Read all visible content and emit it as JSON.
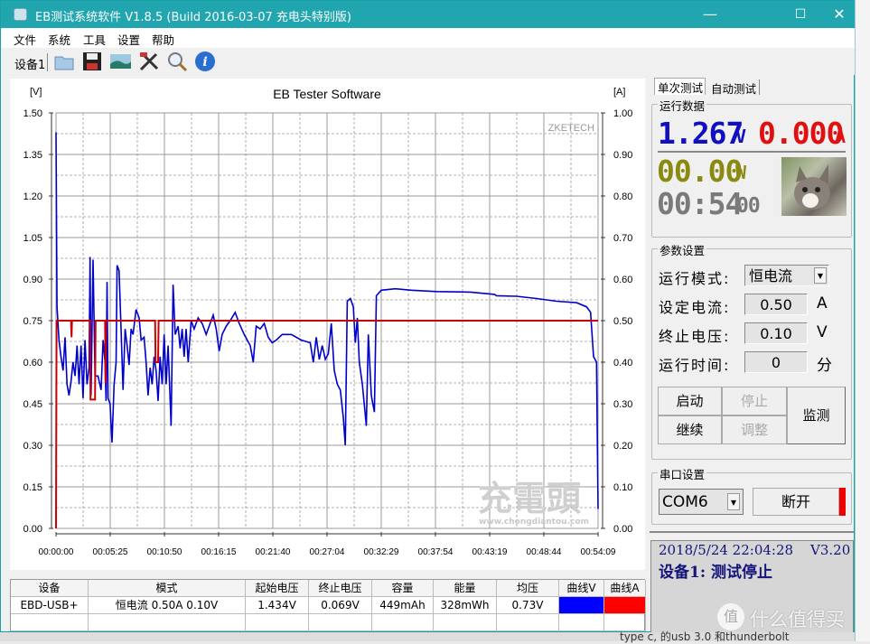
{
  "window": {
    "title": "EB测试系统软件 V1.8.5 (Build 2016-03-07 充电头特别版)",
    "minimize": "—",
    "maximize": "☐",
    "close": "✕"
  },
  "menu": [
    "文件",
    "系统",
    "工具",
    "设置",
    "帮助"
  ],
  "toolbar": {
    "device_tab": "设备1",
    "icons": [
      "open-folder-icon",
      "save-icon",
      "picture-icon",
      "tools-icon",
      "search-icon",
      "info-icon"
    ]
  },
  "chart": {
    "title": "EB Tester Software",
    "left_unit": "[V]",
    "right_unit": "[A]",
    "brand": "ZKETECH",
    "watermark": "充電頭",
    "watermark_url": "www.chongdiantou.com"
  },
  "chart_data": {
    "type": "line",
    "title": "EB Tester Software",
    "x_ticks": [
      "00:00:00",
      "00:05:25",
      "00:10:50",
      "00:16:15",
      "00:21:40",
      "00:27:04",
      "00:32:29",
      "00:37:54",
      "00:43:19",
      "00:48:44",
      "00:54:09"
    ],
    "xlim_minutes": [
      0,
      54.15
    ],
    "y_left": {
      "label": "[V]",
      "lim": [
        0,
        1.5
      ],
      "ticks": [
        "0.00",
        "0.15",
        "0.30",
        "0.45",
        "0.60",
        "0.75",
        "0.90",
        "1.05",
        "1.20",
        "1.35",
        "1.50"
      ]
    },
    "y_right": {
      "label": "[A]",
      "lim": [
        0,
        1.0
      ],
      "ticks": [
        "0.00",
        "0.10",
        "0.20",
        "0.30",
        "0.40",
        "0.50",
        "0.60",
        "0.70",
        "0.80",
        "0.90",
        "1.00"
      ]
    },
    "grid": true,
    "series": [
      {
        "axis": "left",
        "color": "#0000cc",
        "points": [
          [
            0,
            1.43
          ],
          [
            0.1,
            0.8
          ],
          [
            0.3,
            0.68
          ],
          [
            0.5,
            0.62
          ],
          [
            0.7,
            0.57
          ],
          [
            0.9,
            0.69
          ],
          [
            1.1,
            0.52
          ],
          [
            1.3,
            0.48
          ],
          [
            1.5,
            0.53
          ],
          [
            1.7,
            0.6
          ],
          [
            1.9,
            0.55
          ],
          [
            2.1,
            0.66
          ],
          [
            2.3,
            0.52
          ],
          [
            2.5,
            0.66
          ],
          [
            2.7,
            0.47
          ],
          [
            2.9,
            0.68
          ],
          [
            3.1,
            0.52
          ],
          [
            3.3,
            0.58
          ],
          [
            3.4,
            0.98
          ],
          [
            3.5,
            0.48
          ],
          [
            3.7,
            0.97
          ],
          [
            3.9,
            0.55
          ],
          [
            4.2,
            0.55
          ],
          [
            4.5,
            0.5
          ],
          [
            4.7,
            0.68
          ],
          [
            4.9,
            0.6
          ],
          [
            5.0,
            0.46
          ],
          [
            5.1,
            0.89
          ],
          [
            5.2,
            0.47
          ],
          [
            5.4,
            0.45
          ],
          [
            5.6,
            0.31
          ],
          [
            5.8,
            0.52
          ],
          [
            6.0,
            0.6
          ],
          [
            6.1,
            0.95
          ],
          [
            6.3,
            0.93
          ],
          [
            6.5,
            0.72
          ],
          [
            6.7,
            0.5
          ],
          [
            6.9,
            0.72
          ],
          [
            7.1,
            0.66
          ],
          [
            7.3,
            0.59
          ],
          [
            7.5,
            0.72
          ],
          [
            7.7,
            0.7
          ],
          [
            8.0,
            0.79
          ],
          [
            8.3,
            0.76
          ],
          [
            8.5,
            0.68
          ],
          [
            8.8,
            0.69
          ],
          [
            9.0,
            0.6
          ],
          [
            9.2,
            0.48
          ],
          [
            9.4,
            0.58
          ],
          [
            9.6,
            0.52
          ],
          [
            9.8,
            0.62
          ],
          [
            10.0,
            0.57
          ],
          [
            10.2,
            0.46
          ],
          [
            10.4,
            0.62
          ],
          [
            10.6,
            0.52
          ],
          [
            10.8,
            0.7
          ],
          [
            11.0,
            0.52
          ],
          [
            11.2,
            0.66
          ],
          [
            11.5,
            0.37
          ],
          [
            11.7,
            0.88
          ],
          [
            11.9,
            0.7
          ],
          [
            12.2,
            0.73
          ],
          [
            12.4,
            0.65
          ],
          [
            12.6,
            0.72
          ],
          [
            12.8,
            0.62
          ],
          [
            13.0,
            0.72
          ],
          [
            13.2,
            0.6
          ],
          [
            13.5,
            0.75
          ],
          [
            13.8,
            0.72
          ],
          [
            14.2,
            0.76
          ],
          [
            14.6,
            0.74
          ],
          [
            15.0,
            0.7
          ],
          [
            15.4,
            0.74
          ],
          [
            15.7,
            0.77
          ],
          [
            16.0,
            0.72
          ],
          [
            16.3,
            0.64
          ],
          [
            16.6,
            0.7
          ],
          [
            17.0,
            0.73
          ],
          [
            17.4,
            0.75
          ],
          [
            17.9,
            0.78
          ],
          [
            18.3,
            0.74
          ],
          [
            18.8,
            0.7
          ],
          [
            19.4,
            0.66
          ],
          [
            19.7,
            0.6
          ],
          [
            20.0,
            0.73
          ],
          [
            20.4,
            0.72
          ],
          [
            20.8,
            0.74
          ],
          [
            21.2,
            0.69
          ],
          [
            21.6,
            0.67
          ],
          [
            22.0,
            0.68
          ],
          [
            22.6,
            0.7
          ],
          [
            23.5,
            0.7
          ],
          [
            24.5,
            0.68
          ],
          [
            25.4,
            0.67
          ],
          [
            25.7,
            0.6
          ],
          [
            26.0,
            0.69
          ],
          [
            26.3,
            0.61
          ],
          [
            26.6,
            0.66
          ],
          [
            26.9,
            0.61
          ],
          [
            27.2,
            0.63
          ],
          [
            27.5,
            0.74
          ],
          [
            27.8,
            0.57
          ],
          [
            28.1,
            0.52
          ],
          [
            28.4,
            0.5
          ],
          [
            28.7,
            0.4
          ],
          [
            28.9,
            0.3
          ],
          [
            29.1,
            0.82
          ],
          [
            29.4,
            0.83
          ],
          [
            29.7,
            0.8
          ],
          [
            29.9,
            0.67
          ],
          [
            30.1,
            0.76
          ],
          [
            30.3,
            0.6
          ],
          [
            30.6,
            0.52
          ],
          [
            31.0,
            0.37
          ],
          [
            31.2,
            0.7
          ],
          [
            31.5,
            0.48
          ],
          [
            31.8,
            0.42
          ],
          [
            32.0,
            0.84
          ],
          [
            32.5,
            0.86
          ],
          [
            33.9,
            0.865
          ],
          [
            35.5,
            0.86
          ],
          [
            38,
            0.855
          ],
          [
            41.4,
            0.853
          ],
          [
            43.8,
            0.845
          ],
          [
            44.0,
            0.84
          ],
          [
            46,
            0.838
          ],
          [
            48,
            0.83
          ],
          [
            50,
            0.82
          ],
          [
            52,
            0.815
          ],
          [
            53.0,
            0.8
          ],
          [
            53.4,
            0.78
          ],
          [
            53.7,
            0.62
          ],
          [
            54.0,
            0.6
          ],
          [
            54.15,
            0.07
          ]
        ]
      },
      {
        "axis": "right",
        "color": "#cc0000",
        "points": [
          [
            0,
            0
          ],
          [
            0.05,
            0.5
          ],
          [
            1.5,
            0.5
          ],
          [
            1.55,
            0.46
          ],
          [
            1.6,
            0.5
          ],
          [
            3.4,
            0.5
          ],
          [
            3.45,
            0.31
          ],
          [
            3.9,
            0.31
          ],
          [
            3.95,
            0.5
          ],
          [
            4.9,
            0.5
          ],
          [
            4.95,
            0.35
          ],
          [
            5.0,
            0.5
          ],
          [
            9.9,
            0.5
          ],
          [
            9.95,
            0.4
          ],
          [
            10.2,
            0.4
          ],
          [
            10.25,
            0.5
          ],
          [
            54.15,
            0.5
          ]
        ]
      }
    ]
  },
  "table": {
    "headers": [
      "设备",
      "模式",
      "起始电压",
      "终止电压",
      "容量",
      "能量",
      "均压",
      "曲线V",
      "曲线A"
    ],
    "row": [
      "EBD-USB+",
      "恒电流  0.50A  0.10V",
      "1.434V",
      "0.069V",
      "449mAh",
      "328mWh",
      "0.73V"
    ],
    "curve_v_color": "#0000ff",
    "curve_a_color": "#ff0000"
  },
  "tabs": [
    "单次测试",
    "自动测试"
  ],
  "run_data": {
    "label": "运行数据",
    "voltage": "1.267",
    "voltage_unit": "V",
    "current": "0.000",
    "current_unit": "A",
    "power": "00.00",
    "power_unit": "W",
    "time": "00:54",
    "time_sec": "00",
    "voltage_color": "#1010c0",
    "current_color": "#e01010",
    "power_color": "#8a8a10",
    "time_color": "#7a7a7a"
  },
  "params": {
    "label": "参数设置",
    "mode_label": "运行模式:",
    "mode_value": "恒电流",
    "current_label": "设定电流:",
    "current_value": "0.50",
    "current_unit": "A",
    "cutoff_label": "终止电压:",
    "cutoff_value": "0.10",
    "cutoff_unit": "V",
    "time_label": "运行时间:",
    "time_value": "0",
    "time_unit": "分",
    "start": "启动",
    "stop": "停止",
    "continue": "继续",
    "adjust": "调整",
    "monitor": "监测"
  },
  "serial": {
    "label": "串口设置",
    "port": "COM6",
    "disconnect": "断开",
    "indicator_color": "#ee0000"
  },
  "status": {
    "datetime": "2018/5/24 22:04:28",
    "version": "V3.20",
    "message": "设备1: 测试停止"
  },
  "background": {
    "watermark": "什么值得买",
    "watermark_badge": "值",
    "caption": "type c, 的usb 3.0 和thunderbolt"
  }
}
